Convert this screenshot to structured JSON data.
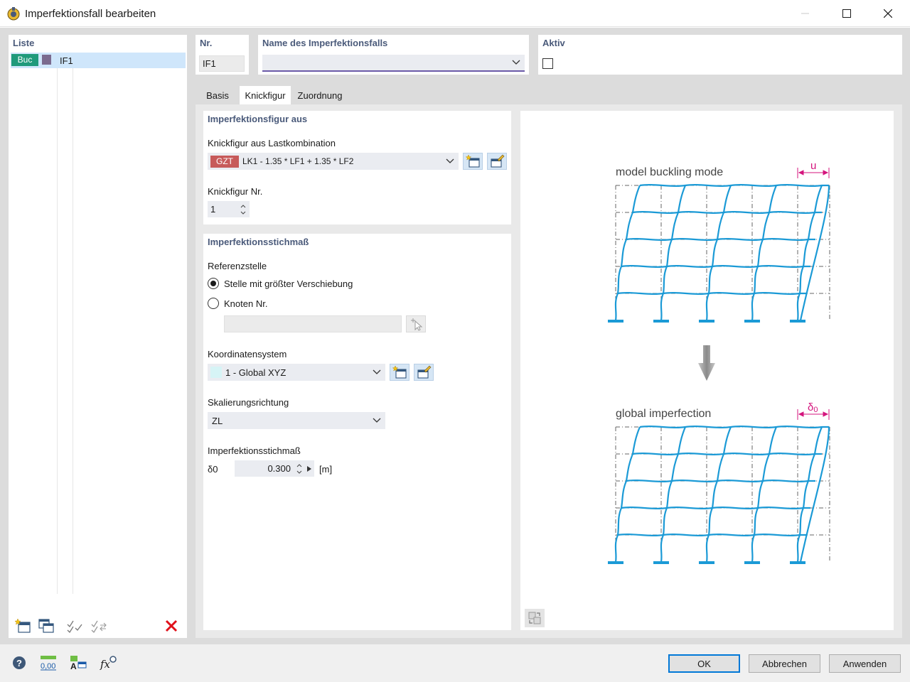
{
  "window": {
    "title": "Imperfektionsfall bearbeiten"
  },
  "liste": {
    "title": "Liste",
    "items": [
      {
        "tag": "Buc",
        "tag_color": "#1f9a7b",
        "color": "#7b6b8f",
        "name": "IF1"
      }
    ]
  },
  "header": {
    "nr_label": "Nr.",
    "nr_value": "IF1",
    "name_label": "Name des Imperfektionsfalls",
    "name_value": "",
    "aktiv_label": "Aktiv",
    "aktiv_checked": false
  },
  "tabs": [
    {
      "label": "Basis"
    },
    {
      "label": "Knickfigur",
      "active": true
    },
    {
      "label": "Zuordnung"
    }
  ],
  "knickfigur": {
    "group_title": "Imperfektionsfigur aus",
    "lk_label": "Knickfigur aus Lastkombination",
    "lk_tag": "GZT",
    "lk_tag_color": "#c75a5a",
    "lk_value": "LK1 - 1.35 * LF1 + 1.35 * LF2",
    "nr_label": "Knickfigur Nr.",
    "nr_value": "1"
  },
  "stichmass": {
    "group_title": "Imperfektionsstichmaß",
    "ref_label": "Referenzstelle",
    "radio1": "Stelle mit größter Verschiebung",
    "radio2": "Knoten Nr.",
    "radio_selected": "radio1",
    "knoten_value": "",
    "coord_label": "Koordinatensystem",
    "coord_value": "1 - Global XYZ",
    "coord_swatch": "#d6f4f6",
    "scale_label": "Skalierungsrichtung",
    "scale_value": "ZL",
    "stichmass_label": "Imperfektionsstichmaß",
    "symbol": "δ0",
    "value": "0.300",
    "unit": "[m]"
  },
  "diagram": {
    "top_label": "model buckling mode",
    "top_dim": "u",
    "bottom_label": "global imperfection",
    "bottom_dim": "δ",
    "bottom_dim_sub": "0",
    "frame_color": "#1b9ad6",
    "dim_color": "#d4147d"
  },
  "buttons": {
    "ok": "OK",
    "cancel": "Abbrechen",
    "apply": "Anwenden"
  },
  "footer_icons": {
    "units_text": "0,00"
  }
}
